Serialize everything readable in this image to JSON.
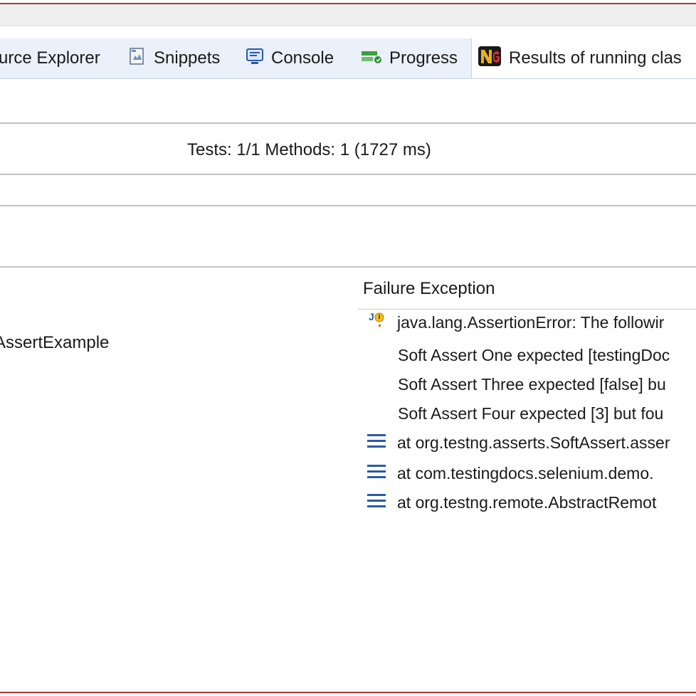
{
  "tabs": [
    {
      "label": "urce Explorer"
    },
    {
      "label": "Snippets",
      "icon": "snippets-icon"
    },
    {
      "label": "Console",
      "icon": "console-icon"
    },
    {
      "label": "Progress",
      "icon": "progress-icon"
    },
    {
      "label": "Results of running clas",
      "icon": "testng-icon",
      "active": true
    }
  ],
  "summary": "Tests: 1/1  Methods: 1 (1727 ms)",
  "test_tree": {
    "item": "AssertExample"
  },
  "failure": {
    "header": "Failure Exception",
    "rows": [
      {
        "text": "java.lang.AssertionError: The followir",
        "icon": "java-error-icon"
      },
      {
        "text": "Soft Assert One expected [testingDoc"
      },
      {
        "text": "Soft Assert Three expected [false] bu"
      },
      {
        "text": "Soft Assert Four expected [3] but fou"
      },
      {
        "text": "at org.testng.asserts.SoftAssert.asser",
        "icon": "stack-frame-icon"
      },
      {
        "text": "at com.testingdocs.selenium.demo.",
        "icon": "stack-frame-icon"
      },
      {
        "text": "at org.testng.remote.AbstractRemot",
        "icon": "stack-frame-icon"
      }
    ]
  },
  "colors": {
    "accent": "#2b5aa8",
    "tabbar": "#eaf1fa",
    "border": "#b03a3a"
  }
}
